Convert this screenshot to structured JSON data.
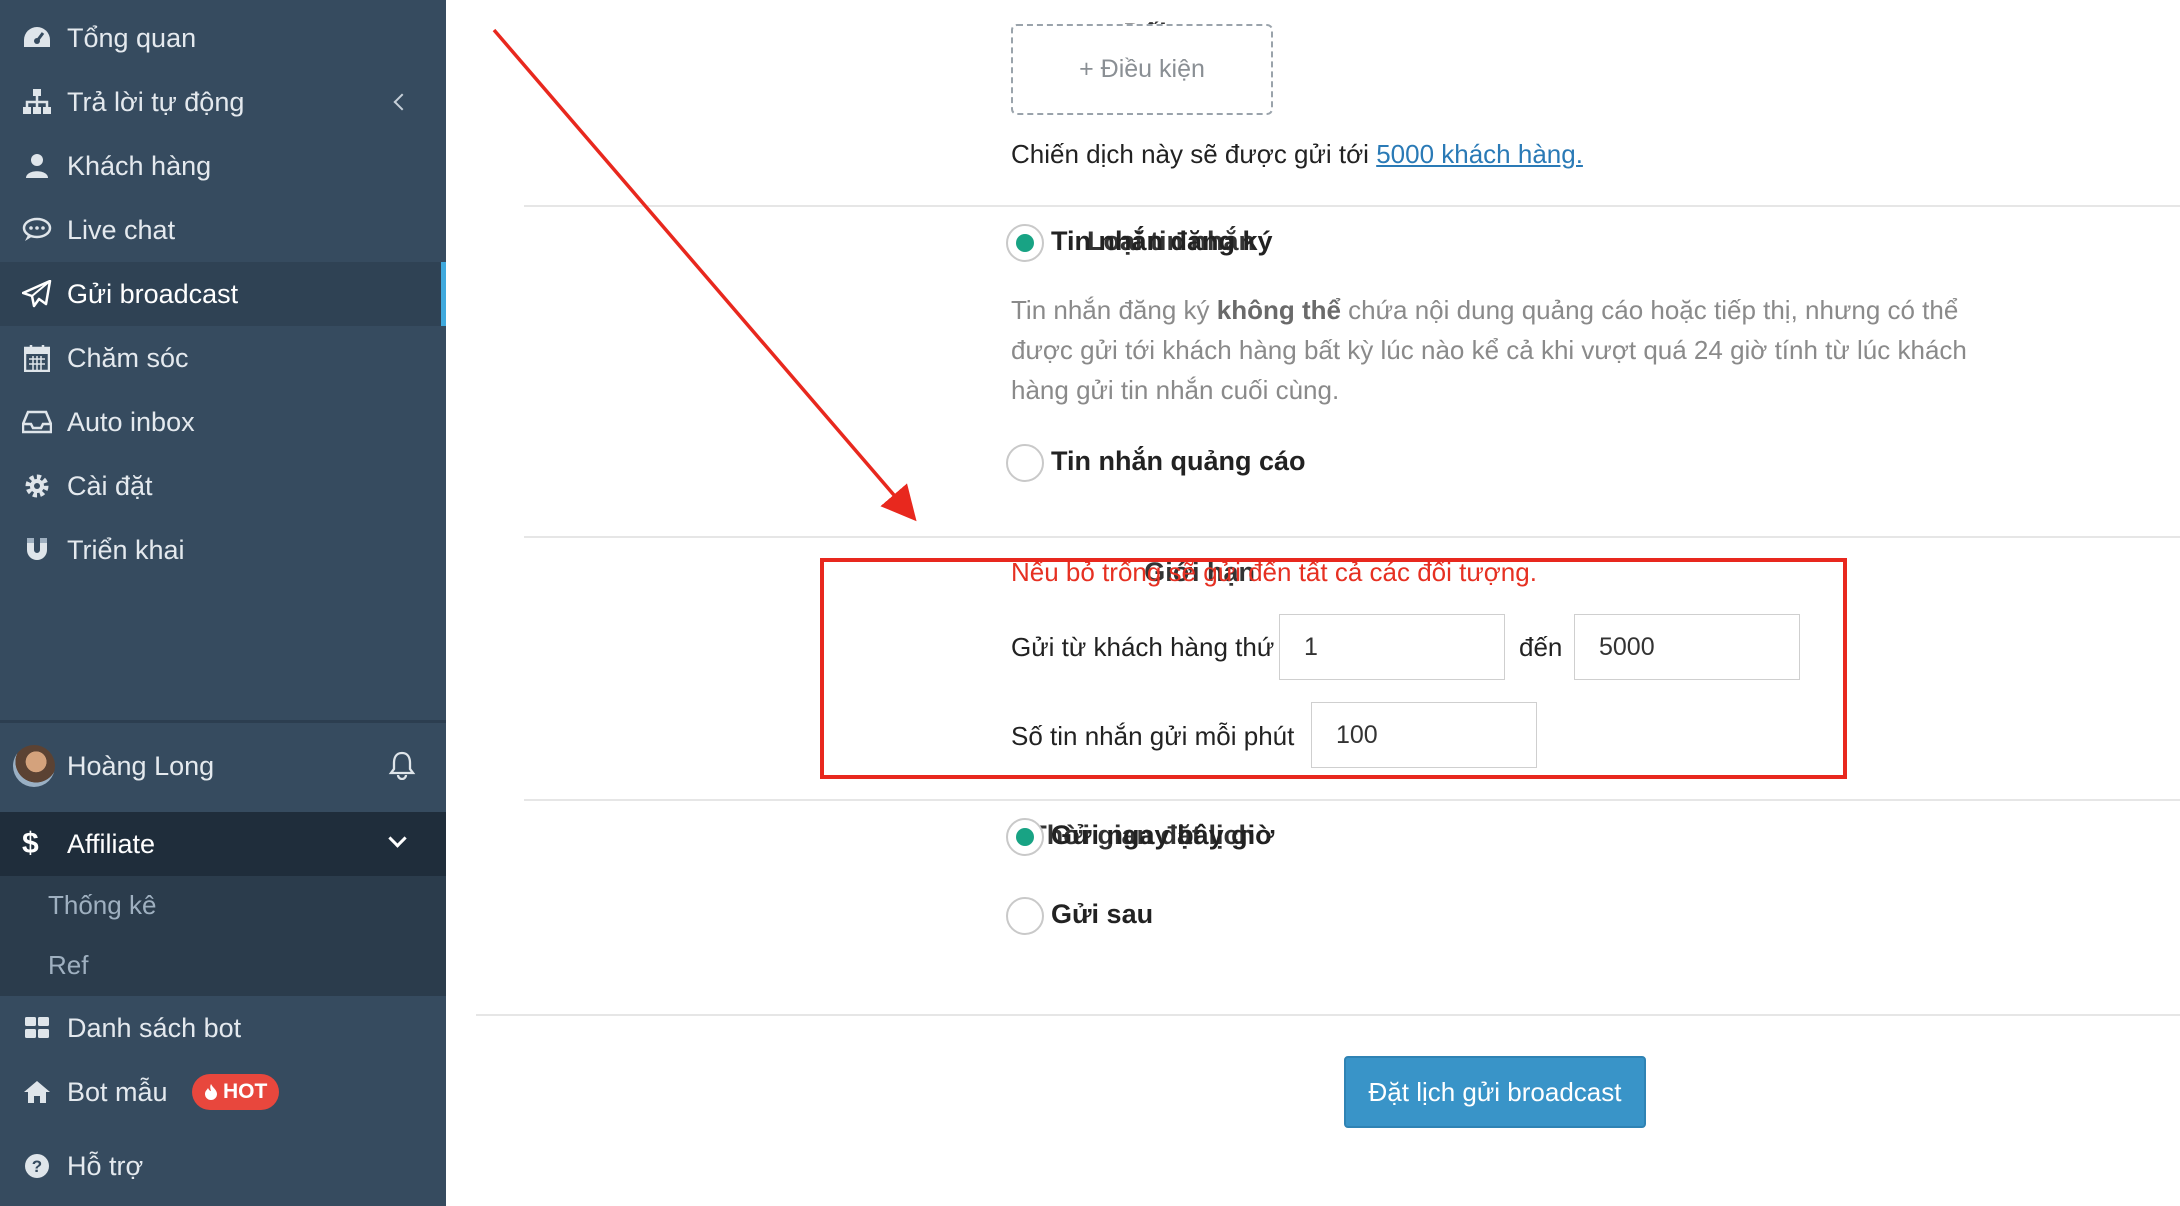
{
  "sidebar": {
    "items": [
      {
        "label": "Tổng quan",
        "icon": "dashboard-icon"
      },
      {
        "label": "Trả lời tự động",
        "icon": "sitemap-icon"
      },
      {
        "label": "Khách hàng",
        "icon": "user-icon"
      },
      {
        "label": "Live chat",
        "icon": "chat-icon"
      },
      {
        "label": "Gửi broadcast",
        "icon": "paper-plane-icon"
      },
      {
        "label": "Chăm sóc",
        "icon": "calendar-icon"
      },
      {
        "label": "Auto inbox",
        "icon": "inbox-icon"
      },
      {
        "label": "Cài đặt",
        "icon": "gear-icon"
      },
      {
        "label": "Triển khai",
        "icon": "magnet-icon"
      }
    ],
    "user_name": "Hoàng Long",
    "affiliate": {
      "label": "Affiliate",
      "icon": "dollar-icon",
      "sub_items": [
        "Thống kê",
        "Ref"
      ]
    },
    "bottom_items": [
      {
        "label": "Danh sách bot",
        "icon": "grid-icon"
      },
      {
        "label": "Bot mẫu",
        "icon": "home-icon",
        "badge": "HOT"
      },
      {
        "label": "Hỗ trợ",
        "icon": "question-icon"
      }
    ],
    "colors": {
      "bg": "#364b5f",
      "active_accent": "#3fa9dd",
      "hot_badge": "#e8473d"
    }
  },
  "form": {
    "audience": {
      "label": "Đối tượng",
      "condition_button": "+ Điều kiện",
      "send_to_prefix": "Chiến dịch này sẽ được gửi tới ",
      "send_to_link": "5000 khách hàng."
    },
    "message_type": {
      "label": "Loại tin nhắn",
      "option_subscription": "Tin nhắn đăng ký",
      "hint_part1": "Tin nhắn đăng ký ",
      "hint_bold": "không thể",
      "hint_part2": " chứa nội dung quảng cáo hoặc tiếp thị, nhưng có thể được gửi tới khách hàng bất kỳ lúc nào kể cả khi vượt quá 24 giờ tính từ lúc khách hàng gửi tin nhắn cuối cùng.",
      "option_promo": "Tin nhắn quảng cáo",
      "selected": "Tin nhắn đăng ký"
    },
    "limit": {
      "label": "Giới hạn",
      "note": "Nếu bỏ trống sẽ gửi đến tất cả các đối tượng.",
      "from_label": "Gửi từ khách hàng thứ",
      "from_value": "1",
      "to_label": "đến",
      "to_value": "5000",
      "rate_label": "Số tin nhắn gửi mỗi phút",
      "rate_value": "100"
    },
    "schedule": {
      "label": "Thời gian đặt lịch",
      "option_now": "Gửi ngay bây giờ",
      "option_later": "Gửi sau",
      "selected": "Gửi ngay bây giờ"
    },
    "submit": "Đặt lịch gửi broadcast",
    "colors": {
      "primary": "#3994c8",
      "radio_selected": "#18a384",
      "annotation": "#e8281e",
      "link": "#2a7ab6"
    }
  }
}
